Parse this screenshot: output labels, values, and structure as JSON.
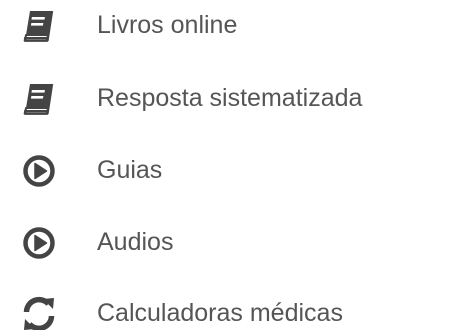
{
  "menu": {
    "items": [
      {
        "label": "Livros online",
        "icon": "book-icon"
      },
      {
        "label": "Resposta sistematizada",
        "icon": "book-icon"
      },
      {
        "label": "Guias",
        "icon": "play-circle-icon"
      },
      {
        "label": "Audios",
        "icon": "play-circle-icon"
      },
      {
        "label": "Calculadoras médicas",
        "icon": "refresh-icon"
      }
    ]
  },
  "colors": {
    "icon": "#444444",
    "text": "#555555",
    "background": "#ffffff"
  }
}
